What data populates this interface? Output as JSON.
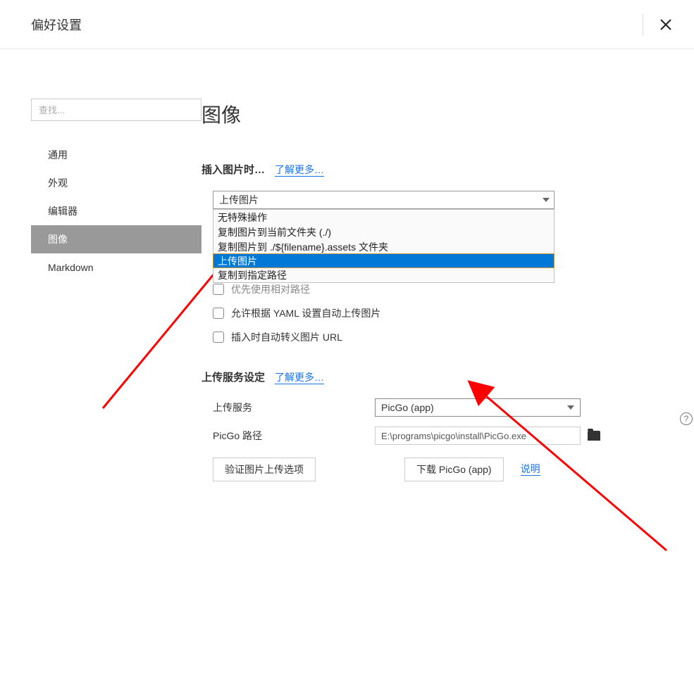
{
  "header": {
    "title": "偏好设置"
  },
  "sidebar": {
    "search_placeholder": "查找...",
    "items": [
      {
        "label": "通用"
      },
      {
        "label": "外观"
      },
      {
        "label": "编辑器"
      },
      {
        "label": "图像"
      },
      {
        "label": "Markdown"
      }
    ]
  },
  "main": {
    "page_title": "图像",
    "insert_section": {
      "label": "插入图片时…",
      "learn_more": "了解更多…",
      "selected": "上传图片",
      "options": [
        "无特殊操作",
        "复制图片到当前文件夹  (./)",
        "复制图片到 ./${filename}.assets 文件夹",
        "上传图片",
        "复制到指定路径"
      ]
    },
    "checkboxes": {
      "relative_path": "优先使用相对路径",
      "yaml_auto": "允许根据 YAML 设置自动上传图片",
      "auto_escape": "插入时自动转义图片 URL"
    },
    "upload_section": {
      "label": "上传服务设定",
      "learn_more": "了解更多…",
      "service_label": "上传服务",
      "service_value": "PicGo (app)",
      "path_label": "PicGo 路径",
      "path_value": "E:\\programs\\picgo\\install\\PicGo.exe",
      "verify_button": "验证图片上传选项",
      "download_button": "下载 PicGo (app)",
      "instructions_link": "说明"
    }
  }
}
